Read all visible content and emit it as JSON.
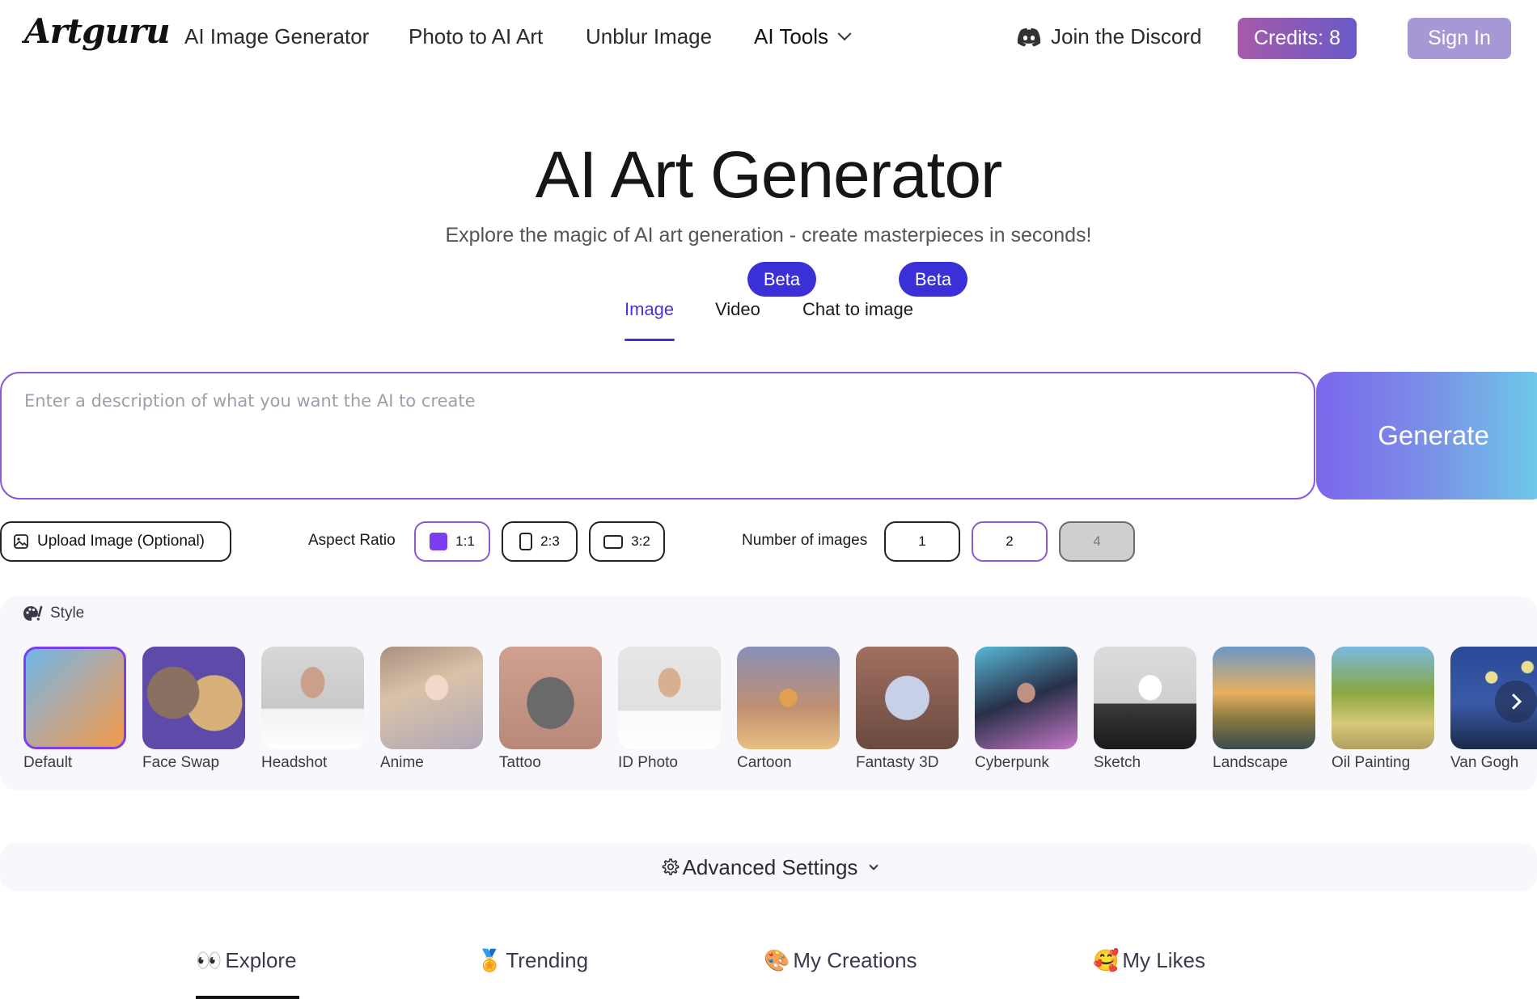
{
  "header": {
    "logo": "Artguru",
    "nav": [
      "AI Image Generator",
      "Photo to AI Art",
      "Unblur Image",
      "AI Tools"
    ],
    "discord": "Join the Discord",
    "credits": "Credits: 8",
    "sign_in": "Sign In"
  },
  "hero": {
    "title": "AI Art Generator",
    "subtitle": "Explore the magic of AI art generation - create masterpieces in seconds!"
  },
  "mode_tabs": {
    "items": [
      "Image",
      "Video",
      "Chat to image"
    ],
    "active": "Image",
    "beta_label": "Beta"
  },
  "prompt": {
    "placeholder": "Enter a description of what you want the AI to create",
    "value": "",
    "generate_label": "Generate"
  },
  "controls": {
    "upload_label": "Upload Image (Optional)",
    "aspect_label": "Aspect Ratio",
    "aspect_options": [
      "1:1",
      "2:3",
      "3:2"
    ],
    "aspect_selected": "1:1",
    "count_label": "Number of images",
    "count_options": [
      "1",
      "2",
      "4"
    ],
    "count_selected": "2",
    "count_disabled": "4"
  },
  "style": {
    "heading": "Style",
    "selected": "Default",
    "items": [
      "Default",
      "Face Swap",
      "Headshot",
      "Anime",
      "Tattoo",
      "ID Photo",
      "Cartoon",
      "Fantasty 3D",
      "Cyberpunk",
      "Sketch",
      "Landscape",
      "Oil Painting",
      "Van Gogh"
    ]
  },
  "advanced": {
    "label": "Advanced Settings"
  },
  "feed_tabs": {
    "items": [
      {
        "emoji": "👀",
        "label": "Explore"
      },
      {
        "emoji": "🏅",
        "label": "Trending"
      },
      {
        "emoji": "🎨",
        "label": "My Creations"
      },
      {
        "emoji": "🥰",
        "label": "My Likes"
      }
    ],
    "active": "Explore"
  },
  "colors": {
    "accent": "#7b3ff0",
    "tab_active": "#4a34d6",
    "beta_bg": "#3b30d8"
  }
}
